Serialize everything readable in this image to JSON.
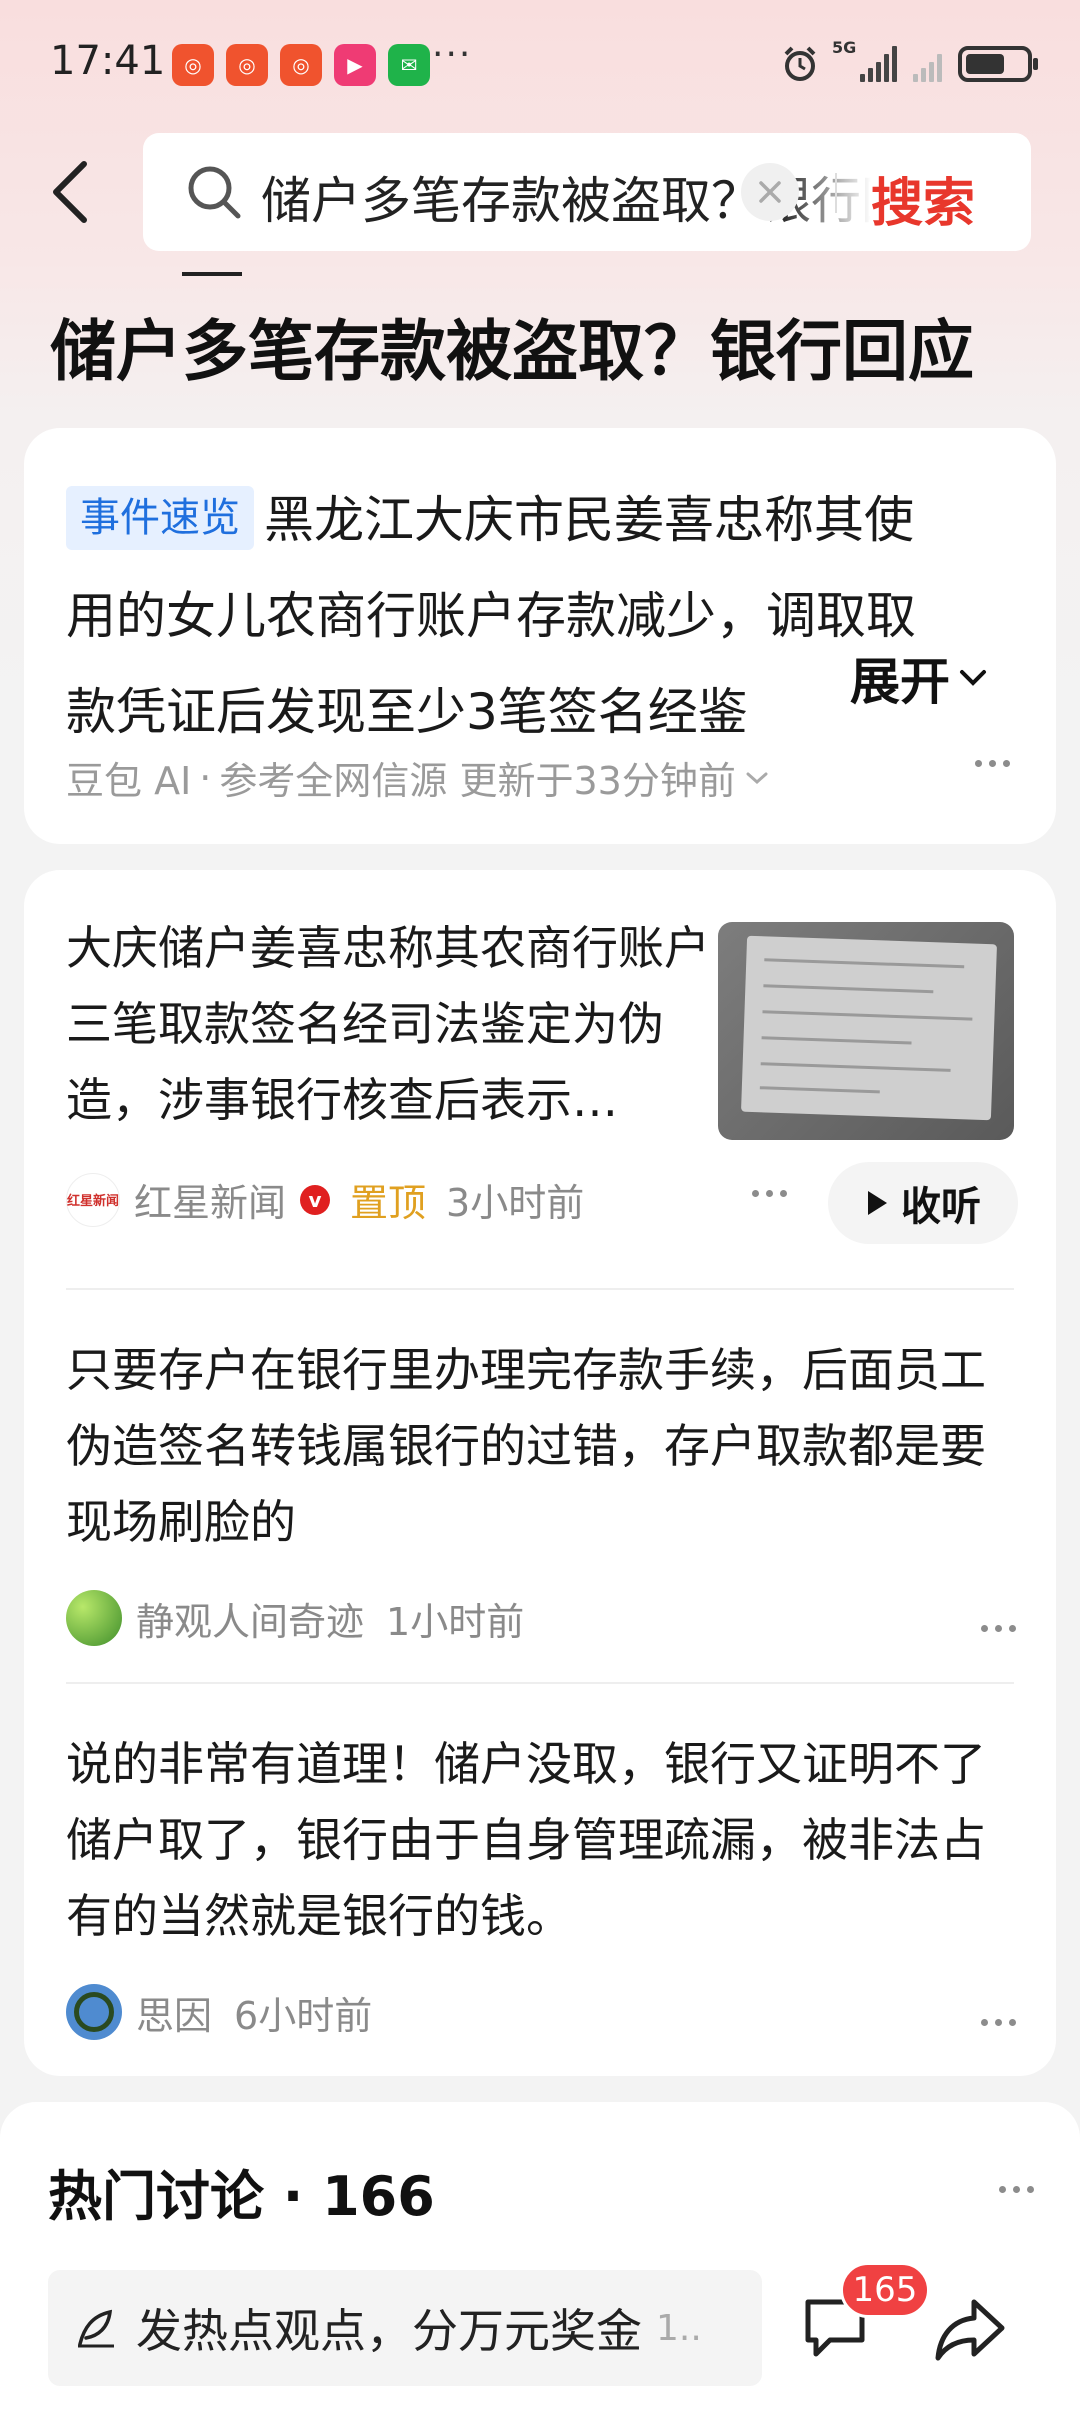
{
  "status_bar": {
    "time": "17:41",
    "network": "5G",
    "more": "···"
  },
  "search": {
    "query": "储户多笔存款被盗取？银行回应",
    "submit_label": "搜索"
  },
  "page_title": "储户多笔存款被盗取？银行回应",
  "summary": {
    "tag": "事件速览",
    "line1": "黑龙江大庆市民姜喜忠称其使",
    "line2": "用的女儿农商行账户存款减少，调取取",
    "line3": "款凭证后发现至少3笔签名经鉴",
    "expand_label": "展开",
    "source": "豆包 AI",
    "meta": "参考全网信源 更新于33分钟前"
  },
  "news": {
    "title": "大庆储户姜喜忠称其农商行账户三笔取款签名经司法鉴定为伪造，涉事银行核查后表示…",
    "source_logo_text": "红星新闻",
    "source": "红星新闻",
    "verified_mark": "v",
    "pinned": "置顶",
    "time": "3小时前",
    "listen_label": "收听"
  },
  "comments": [
    {
      "text": "只要存户在银行里办理完存款手续，后面员工伪造签名转钱属银行的过错，存户取款都是要现场刷脸的",
      "author": "静观人间奇迹",
      "time": "1小时前"
    },
    {
      "text": "说的非常有道理！储户没取，银行又证明不了储户取了，银行由于自身管理疏漏，被非法占有的当然就是银行的钱。",
      "author": "思因",
      "time": "6小时前"
    }
  ],
  "hot_discussion": {
    "title": "热门讨论 · 166",
    "post_placeholder": "发热点观点，分万元奖金",
    "post_extra": "1..",
    "comment_count": "165"
  },
  "colors": {
    "accent": "#e8372c",
    "tag_blue": "#1f6fde",
    "pinned": "#e0a020"
  }
}
